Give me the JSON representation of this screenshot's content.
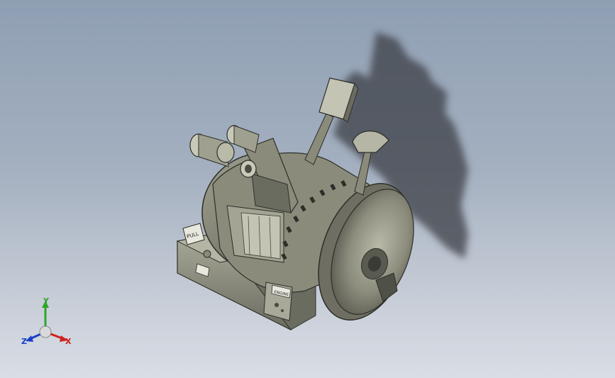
{
  "viewport": {
    "background_top": "#8f9fb3",
    "background_bottom": "#d9dde5"
  },
  "model": {
    "body_color": "#7c7d6f",
    "body_light": "#a3a493",
    "body_dark": "#4a4b42",
    "shadow_color": "#3d4047",
    "panel_text_left": "PULL",
    "panel_text_front": "ENGINE"
  },
  "triad": {
    "x_label": "X",
    "y_label": "Y",
    "z_label": "Z",
    "x_color": "#d0201a",
    "y_color": "#2fa52b",
    "z_color": "#1a3fc8"
  }
}
